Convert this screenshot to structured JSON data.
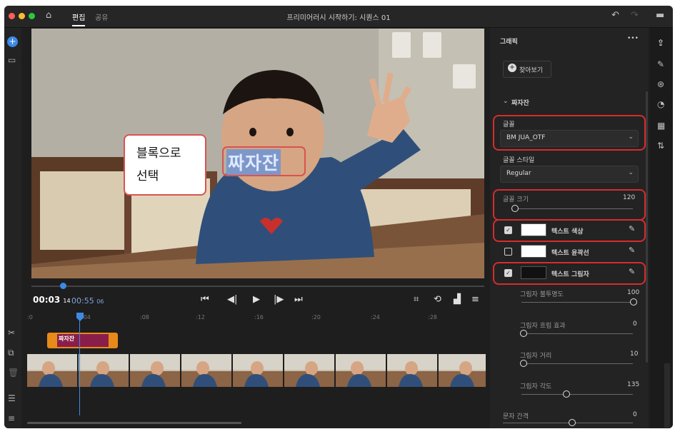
{
  "titlebar": {
    "title": "프리미어러시 시작하기: 시퀀스 01",
    "tabs": [
      {
        "label": "편집",
        "active": true
      },
      {
        "label": "공유",
        "active": false
      }
    ]
  },
  "overlay": {
    "callout_line1": "블록으로",
    "callout_line2": "선택",
    "selected_text": "짜자잔"
  },
  "transport": {
    "current_time": "00:03",
    "current_frames": "14",
    "duration": "00:55",
    "duration_frames": "06"
  },
  "ruler": {
    "ticks": [
      ":0",
      ":04",
      ":08",
      ":12",
      ":16",
      ":20",
      ":24",
      ":28"
    ]
  },
  "timeline": {
    "title_clip_label": "짜자잔"
  },
  "panel": {
    "header": "그래픽",
    "more": "•••",
    "browse_button": "찾아보기",
    "section": "짜자잔",
    "font_label": "글꼴",
    "font_value": "BM JUA_OTF",
    "style_label": "글꼴 스타일",
    "style_value": "Regular",
    "size_label": "글꼴 크기",
    "size_value": "120",
    "size_fraction": 0.05,
    "text_color": {
      "label": "텍스트 색상",
      "checked": true,
      "color": "#ffffff"
    },
    "text_outline": {
      "label": "텍스트 윤곽선",
      "checked": false,
      "color": "#ffffff"
    },
    "text_shadow": {
      "label": "텍스트 그림자",
      "checked": true,
      "color": "#111111"
    },
    "shadow_opacity": {
      "label": "그림자 불투명도",
      "value": "100",
      "fraction": 1.0
    },
    "shadow_blur": {
      "label": "그림자 흐림 효과",
      "value": "0",
      "fraction": 0.0
    },
    "shadow_distance": {
      "label": "그림자 거리",
      "value": "10",
      "fraction": 0.0
    },
    "shadow_angle": {
      "label": "그림자 각도",
      "value": "135",
      "fraction": 0.38
    },
    "char_spacing": {
      "label": "문자 간격",
      "value": "0",
      "fraction": 0.5
    }
  },
  "colors": {
    "accent": "#3b8ae6",
    "highlight": "#d92b2b",
    "clip_orange": "#e88a1a",
    "clip_purple": "#8a1e4a"
  }
}
